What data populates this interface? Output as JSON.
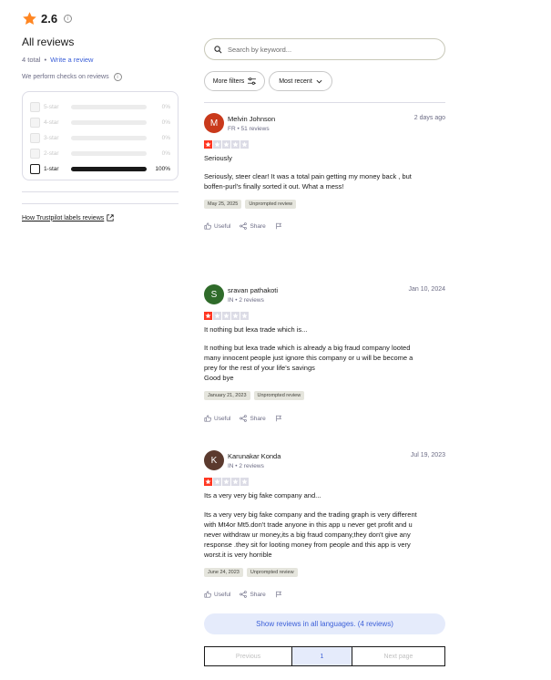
{
  "header": {
    "score": "2.6",
    "star_color": "#ff8622"
  },
  "summary": {
    "title": "All reviews",
    "total": "4 total",
    "separator": "•",
    "write_review": "Write a review",
    "checks_text": "We perform checks on reviews",
    "trust_link": "How Trustpilot labels reviews"
  },
  "filters": [
    {
      "label": "5-star",
      "pct": "0%",
      "fill": 0,
      "active": false
    },
    {
      "label": "4-star",
      "pct": "0%",
      "fill": 0,
      "active": false
    },
    {
      "label": "3-star",
      "pct": "0%",
      "fill": 0,
      "active": false
    },
    {
      "label": "2-star",
      "pct": "0%",
      "fill": 0,
      "active": false
    },
    {
      "label": "1-star",
      "pct": "100%",
      "fill": 1,
      "active": true
    }
  ],
  "search": {
    "placeholder": "Search by keyword..."
  },
  "toolbar": {
    "more_filters": "More filters",
    "sort": "Most recent"
  },
  "reviews": [
    {
      "initial": "M",
      "avatar_color": "#c9391b",
      "name": "Melvin Johnson",
      "meta": "FR • 51 reviews",
      "date": "2 days ago",
      "rating": 1,
      "title": "Seriously",
      "body": "Seriously, steer clear! It was a total pain getting my money back , but\nboffen-purl's finally sorted it out. What a mess!",
      "tag_date": "May 25, 2025",
      "tag_label": "Unprompted review",
      "useful": "Useful",
      "share": "Share"
    },
    {
      "initial": "S",
      "avatar_color": "#2f6b2a",
      "name": "sravan pathakoti",
      "meta": "IN • 2 reviews",
      "date": "Jan 10, 2024",
      "rating": 1,
      "title": "It nothing but lexa trade which is...",
      "body": "It nothing but lexa trade which is already a big fraud company looted\nmany innocent people just ignore this company or u will be become a\nprey for the rest of your life's savings\nGood bye",
      "tag_date": "January 21, 2023",
      "tag_label": "Unprompted review",
      "useful": "Useful",
      "share": "Share"
    },
    {
      "initial": "K",
      "avatar_color": "#5b3a2e",
      "name": "Karunakar Konda",
      "meta": "IN • 2 reviews",
      "date": "Jul 19, 2023",
      "rating": 1,
      "title": "Its a very very big fake company and...",
      "body": "Its a very very big fake company and the trading graph is very different\nwith Mt4or Mt5.don't trade anyone in this app u never get profit and u\nnever withdraw ur money,its a big fraud company,they don't give any\nresponse .they sit for looting money from people and this app is very\nworst.it is very horrible",
      "tag_date": "June 24, 2023",
      "tag_label": "Unprompted review",
      "useful": "Useful",
      "share": "Share"
    }
  ],
  "show_all": "Show reviews in all languages. (4 reviews)",
  "pagination": {
    "prev": "Previous",
    "current": "1",
    "next": "Next page"
  }
}
